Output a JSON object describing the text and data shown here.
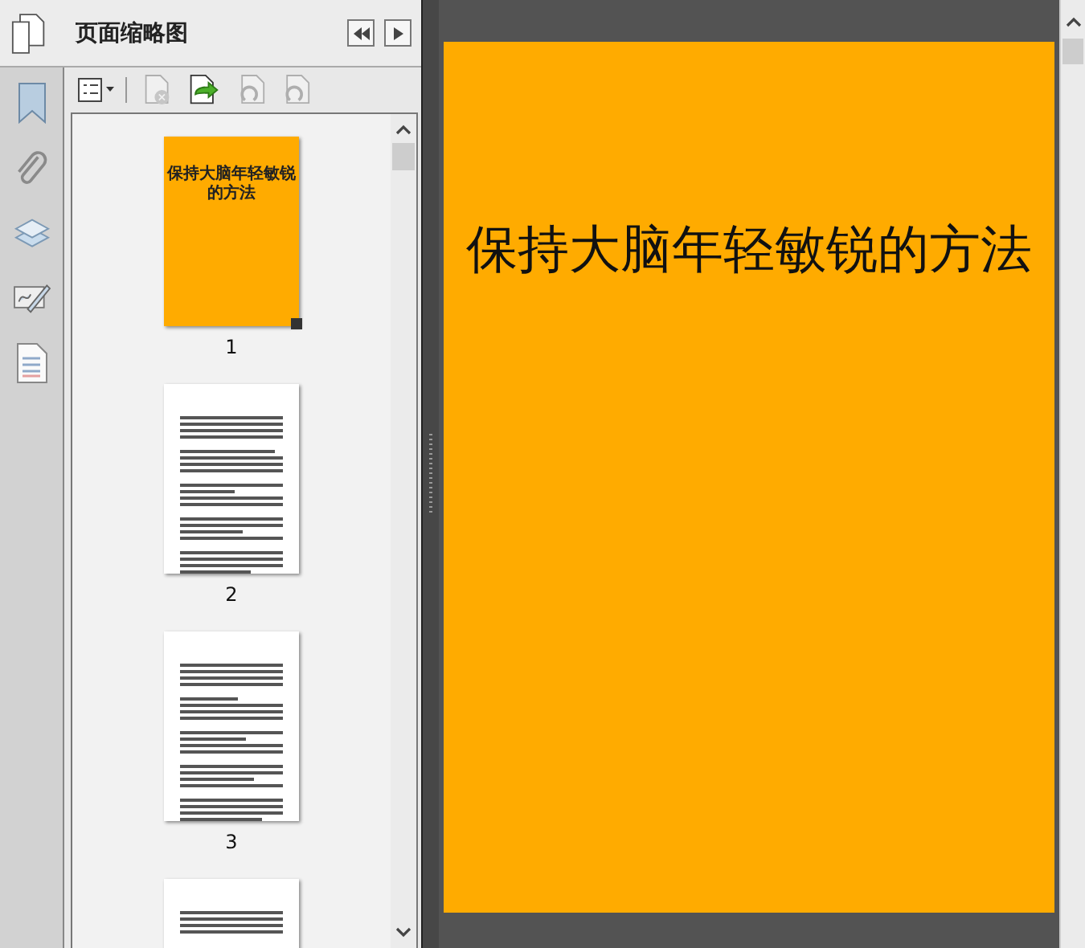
{
  "panel": {
    "title": "页面缩略图"
  },
  "sidebar": [
    {
      "kind": "bookmark"
    },
    {
      "kind": "attachment"
    },
    {
      "kind": "layers"
    },
    {
      "kind": "signature"
    },
    {
      "kind": "document"
    }
  ],
  "toolbar": [
    {
      "kind": "options",
      "disabled": false
    },
    {
      "kind": "delete",
      "disabled": true
    },
    {
      "kind": "insert",
      "disabled": false
    },
    {
      "kind": "rotate-left",
      "disabled": true
    },
    {
      "kind": "rotate-right",
      "disabled": true
    }
  ],
  "thumbnails": [
    {
      "kind": "title",
      "title": "保持大脑年轻敏锐的方法",
      "label": "1",
      "selected": true
    },
    {
      "kind": "text",
      "label": "2",
      "selected": false
    },
    {
      "kind": "text",
      "label": "3",
      "selected": false
    },
    {
      "kind": "text",
      "selected": false
    }
  ],
  "document": {
    "title": "保持大脑年轻敏锐的方法"
  }
}
